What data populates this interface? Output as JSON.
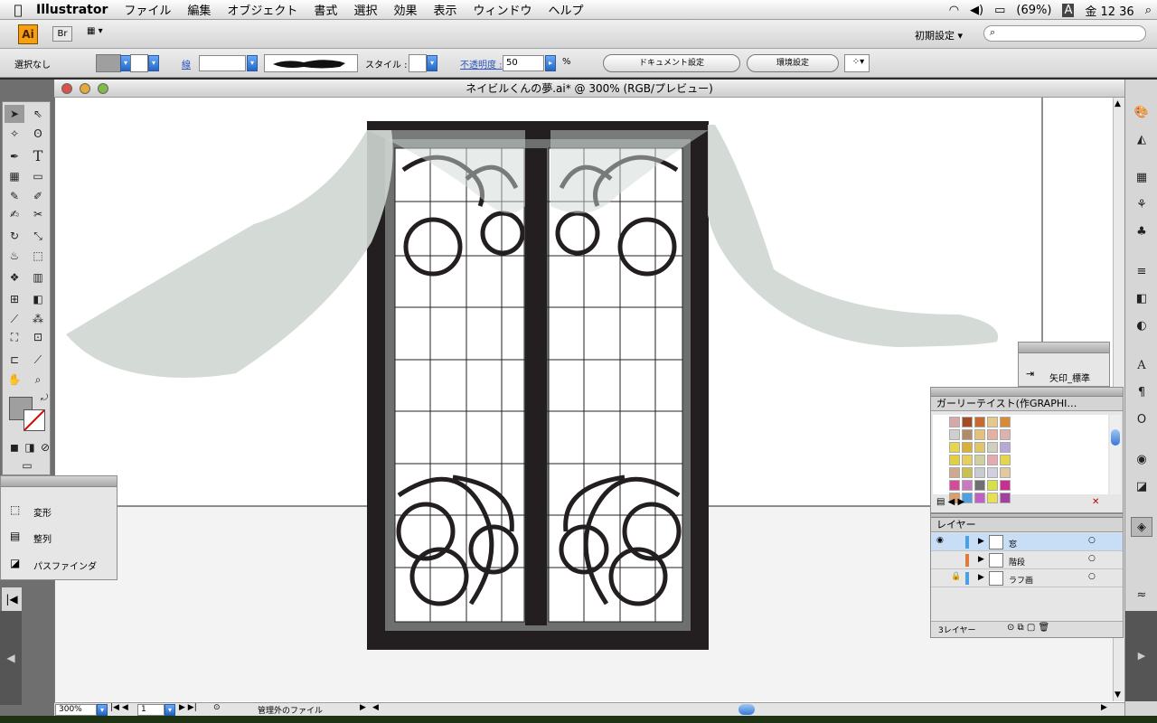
{
  "menubar": {
    "app": "Illustrator",
    "items": [
      "ファイル",
      "編集",
      "オブジェクト",
      "書式",
      "選択",
      "効果",
      "表示",
      "ウィンドウ",
      "ヘルプ"
    ],
    "battery": "(69%)",
    "input_mode": "A",
    "clock": "金 12 36"
  },
  "appbar": {
    "ai_logo": "Ai",
    "bridge": "Br",
    "workspace": "初期設定 ▾"
  },
  "control": {
    "selection": "選択なし",
    "stroke_label": "線",
    "style_label": "スタイル :",
    "opacity_label": "不透明度 :",
    "opacity_value": "50",
    "percent": "%",
    "doc_settings": "ドキュメント設定",
    "prefs": "環境設定"
  },
  "document": {
    "title": "ネイビルくんの夢.ai* @ 300% (RGB/プレビュー)"
  },
  "status": {
    "zoom": "300%",
    "page": "1",
    "file_status": "管理外のファイル"
  },
  "panels": {
    "transform": {
      "items": [
        "変形",
        "整列",
        "パスファインダ"
      ]
    },
    "arrow": {
      "label": "矢印_標準"
    },
    "swatch": {
      "title": "ガーリーテイスト(作GRAPHI…"
    },
    "layers": {
      "title": "レイヤー",
      "rows": [
        "窓",
        "階段",
        "ラフ画"
      ],
      "count": "3レイヤー"
    }
  },
  "colors": {
    "curtain": "#cfd7d3",
    "frame_dark": "#231f20",
    "frame_gray": "#6d706e",
    "accent_blue": "#3a78d6"
  },
  "swatches": [
    "#d9a7a5",
    "#a64a23",
    "#c86a2e",
    "#e6c989",
    "#d8893a",
    "#cfcfcf",
    "#b08a69",
    "#e3c27a",
    "#e6b0a0",
    "#dbb2b0",
    "#e8d54f",
    "#d9b03a",
    "#e0c66a",
    "#cfcfbf",
    "#b8a8d8",
    "#e2d040",
    "#e6cf5f",
    "#cfcf9f",
    "#e8a8b0",
    "#e6d54a",
    "#d0a890",
    "#c8c050",
    "#c8ccd0",
    "#d0d0e0",
    "#e2c8a0",
    "#d64a9a",
    "#c879c0",
    "#707070",
    "#d8e048",
    "#c83090",
    "#d8a070",
    "#50a0e0",
    "#c060c0",
    "#e8e050",
    "#a040a0"
  ]
}
